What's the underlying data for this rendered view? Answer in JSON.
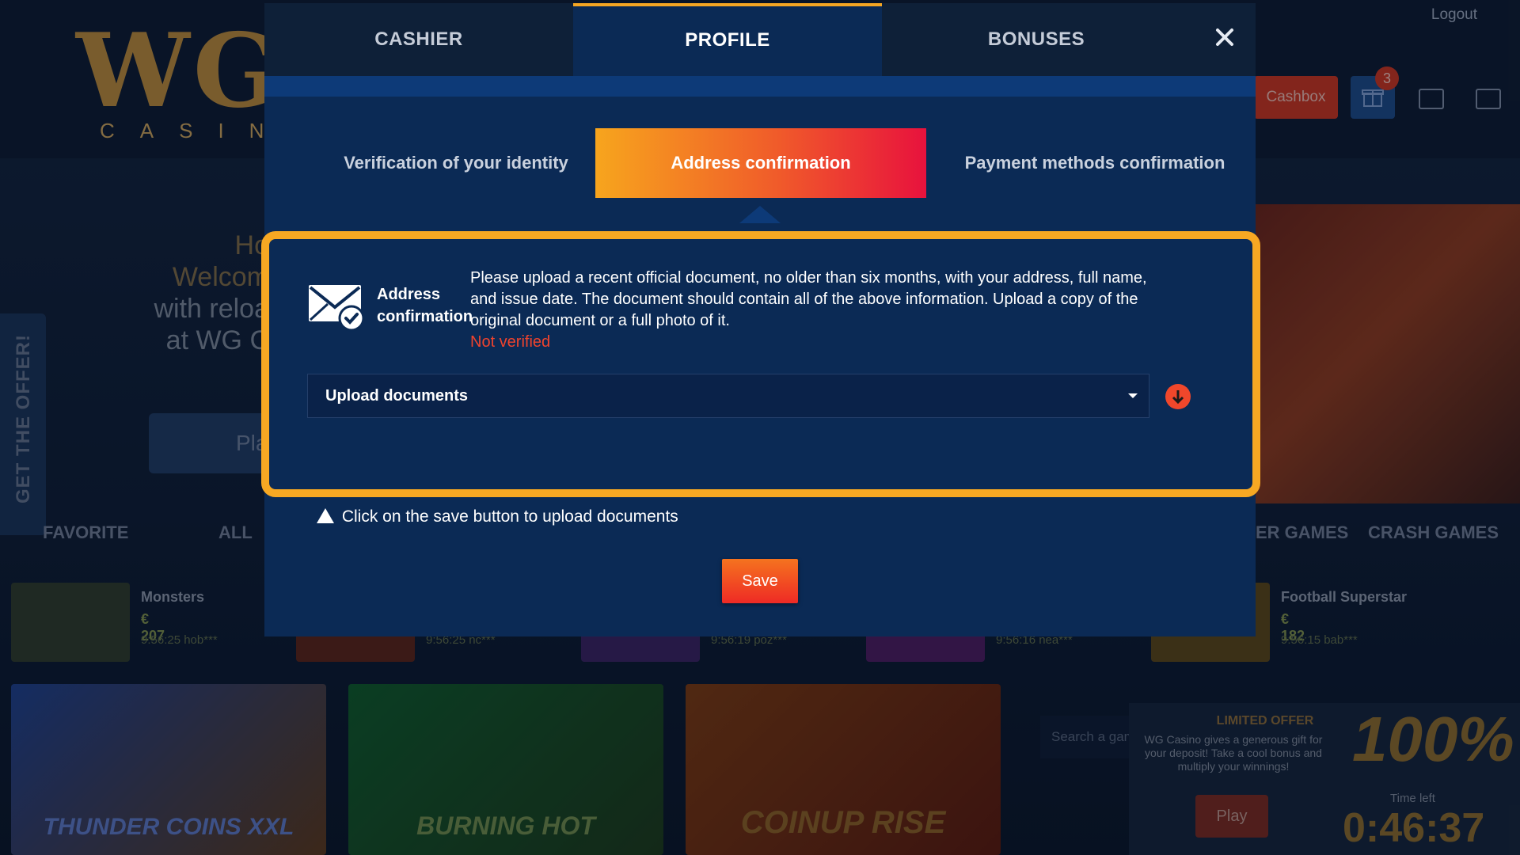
{
  "background": {
    "logout_label": "Logout",
    "logo_text": "WG",
    "logo_sub": "CASINO",
    "cashbox_label": "Cashbox",
    "gift_badge_count": "3",
    "hero_lines": [
      "Ho",
      "Welcom",
      "with reloa",
      "at WG C"
    ],
    "hero_play_label": "Pla",
    "offer_tab_label": "GET THE OFFER!",
    "categories": {
      "favorite": "FAVORITE",
      "all": "ALL",
      "other_games": "ER GAMES",
      "crash_games": "CRASH GAMES"
    },
    "winners": [
      {
        "name": "Monsters",
        "amount": "€ 207",
        "time": "9:56:25 hob***"
      },
      {
        "name": "",
        "amount": "",
        "time": "9:56:25 nc***"
      },
      {
        "name": "",
        "amount": "",
        "time": "9:56:19 poz***"
      },
      {
        "name": "",
        "amount": "",
        "time": "9:56:16 nea***"
      },
      {
        "name": "Football Superstar",
        "amount": "€ 182",
        "time": "9:56:15 bab***"
      }
    ],
    "game_tiles": [
      "THUNDER COINS XXL",
      "BURNING HOT",
      "COINUP RISE"
    ],
    "search_placeholder": "Search a gam",
    "promo": {
      "title": "LIMITED OFFER",
      "text": "WG Casino gives a generous gift for your deposit! Take a cool bonus and multiply your winnings!",
      "play_label": "Play",
      "big_label": "100%",
      "time_left_label": "Time left",
      "timer": "0:46:37"
    }
  },
  "modal": {
    "tabs": [
      {
        "label": "CASHIER",
        "active": false
      },
      {
        "label": "PROFILE",
        "active": true
      },
      {
        "label": "BONUSES",
        "active": false
      }
    ],
    "close_icon": "close-icon",
    "subtabs": [
      {
        "label": "Verification of your identity",
        "active": false
      },
      {
        "label": "Address confirmation",
        "active": true
      },
      {
        "label": "Payment methods confirmation",
        "active": false
      }
    ],
    "panel": {
      "icon": "mail-check-icon",
      "title": "Address confirmation",
      "description": "Please upload a recent official document, no older than six months, with your address, full name, and issue date. The document should contain all of the above information. Upload a copy of the original document or a full photo of it.",
      "status": "Not verified",
      "upload_select_value": "Upload documents"
    },
    "hint": "Click on the save button to upload documents",
    "save_label": "Save"
  },
  "colors": {
    "modal_bg": "#0b2a55",
    "accent_orange": "#f7a823",
    "active_subtab_start": "#f7a51d",
    "active_subtab_end": "#e8123d",
    "status_red": "#f0432d",
    "save_red": "#ee2a25"
  }
}
